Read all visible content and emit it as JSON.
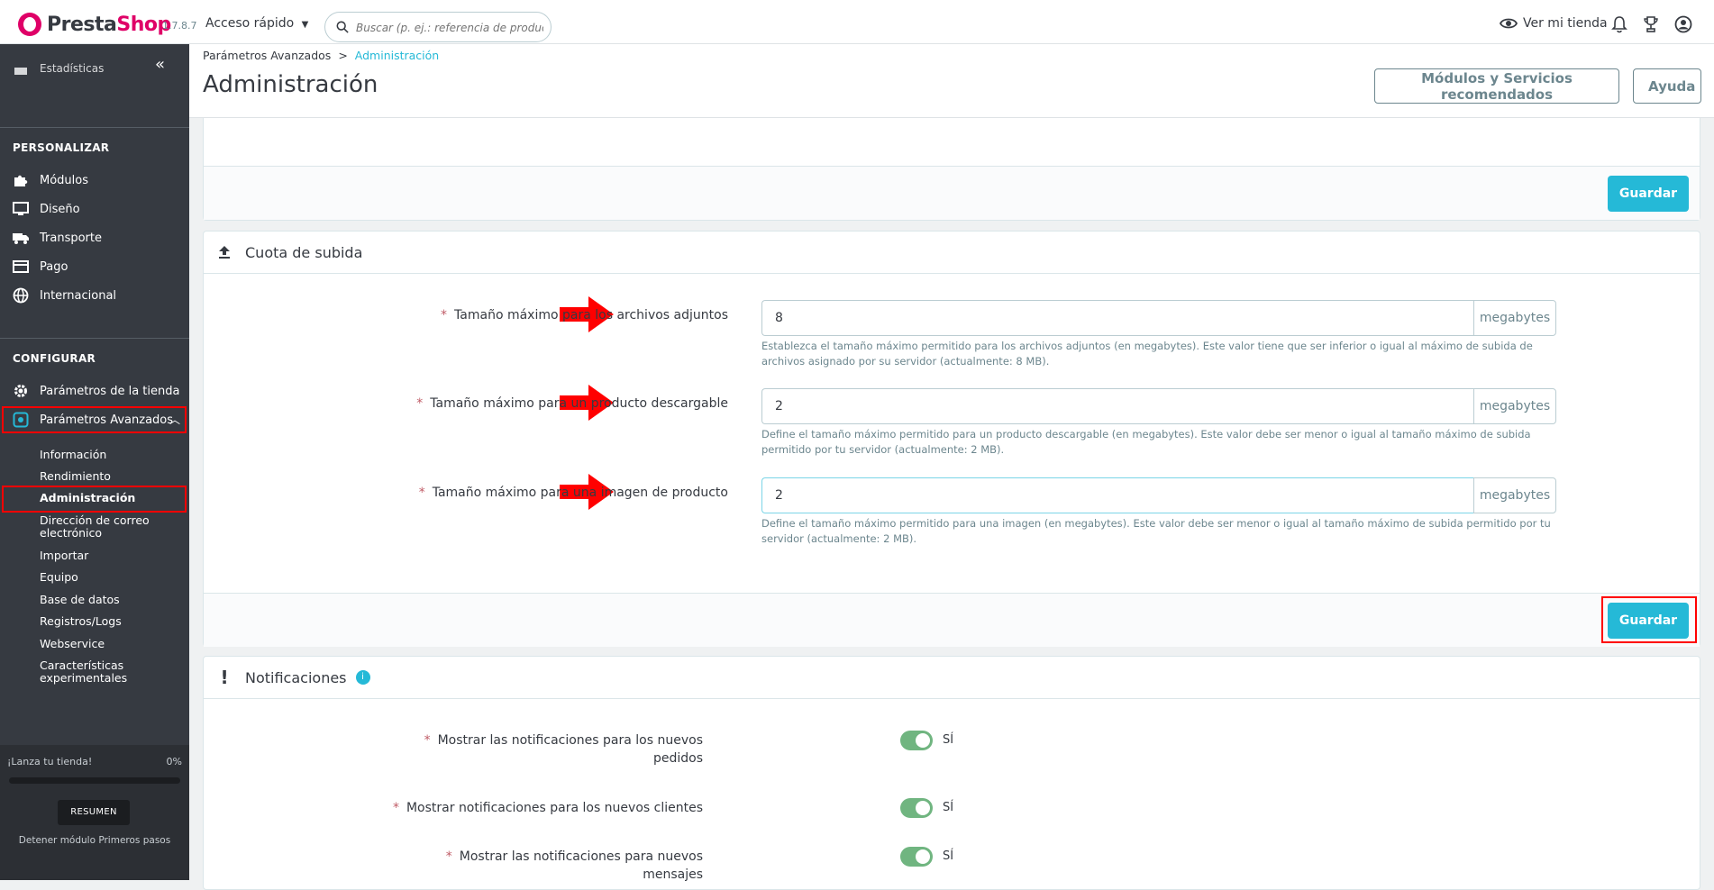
{
  "header": {
    "logo_prefix": "Presta",
    "logo_suffix": "Shop",
    "version": "1.7.8.7",
    "quick_access": "Acceso rápido",
    "search_placeholder": "Buscar (p. ej.: referencia de producto,",
    "view_store": "Ver mi tienda"
  },
  "sidebar": {
    "partial_item": "Estadísticas",
    "section_personalize": "PERSONALIZAR",
    "personalize_items": [
      "Módulos",
      "Diseño",
      "Transporte",
      "Pago",
      "Internacional"
    ],
    "section_configure": "CONFIGURAR",
    "configure_items": [
      "Parámetros de la tienda",
      "Parámetros Avanzados"
    ],
    "sub_items": [
      "Información",
      "Rendimiento",
      "Administración",
      "Dirección de correo electrónico",
      "Importar",
      "Equipo",
      "Base de datos",
      "Registros/Logs",
      "Webservice",
      "Características experimentales"
    ],
    "launch_label": "¡Lanza tu tienda!",
    "launch_percent": "0%",
    "launch_progress": 0,
    "resume_button": "RESUMEN",
    "stop_link": "Detener módulo Primeros pasos"
  },
  "page": {
    "breadcrumb_parent": "Parámetros Avanzados",
    "breadcrumb_sep": ">",
    "breadcrumb_current": "Administración",
    "title": "Administración",
    "btn_recommended": "Módulos y Servicios recomendados",
    "btn_help": "Ayuda"
  },
  "save_label": "Guardar",
  "upload_panel": {
    "title": "Cuota de subida",
    "fields": [
      {
        "label": "Tamaño máximo para los archivos adjuntos",
        "value": "8",
        "unit": "megabytes",
        "help": "Establezca el tamaño máximo permitido para los archivos adjuntos (en megabytes). Este valor tiene que ser inferior o igual al máximo de subida de archivos asignado por su servidor (actualmente: 8 MB)."
      },
      {
        "label": "Tamaño máximo para un producto descargable",
        "value": "2",
        "unit": "megabytes",
        "help": "Define el tamaño máximo permitido para un producto descargable (en megabytes). Este valor debe ser menor o igual al tamaño máximo de subida permitido por tu servidor (actualmente: 2 MB)."
      },
      {
        "label": "Tamaño máximo para una imagen de producto",
        "value": "2",
        "unit": "megabytes",
        "help": "Define el tamaño máximo permitido para una imagen (en megabytes). Este valor debe ser menor o igual al tamaño máximo de subida permitido por tu servidor (actualmente: 2 MB)."
      }
    ]
  },
  "notifications_panel": {
    "title": "Notificaciones",
    "items": [
      {
        "label": "Mostrar las notificaciones para los nuevos pedidos",
        "value": "SÍ"
      },
      {
        "label": "Mostrar notificaciones para los nuevos clientes",
        "value": "SÍ"
      },
      {
        "label": "Mostrar las notificaciones para nuevos mensajes",
        "value": "SÍ"
      }
    ]
  },
  "colors": {
    "accent": "#25b9d7",
    "highlight": "#ff0000",
    "sidebar_bg": "#363a41",
    "toggle_on": "#70b580"
  }
}
